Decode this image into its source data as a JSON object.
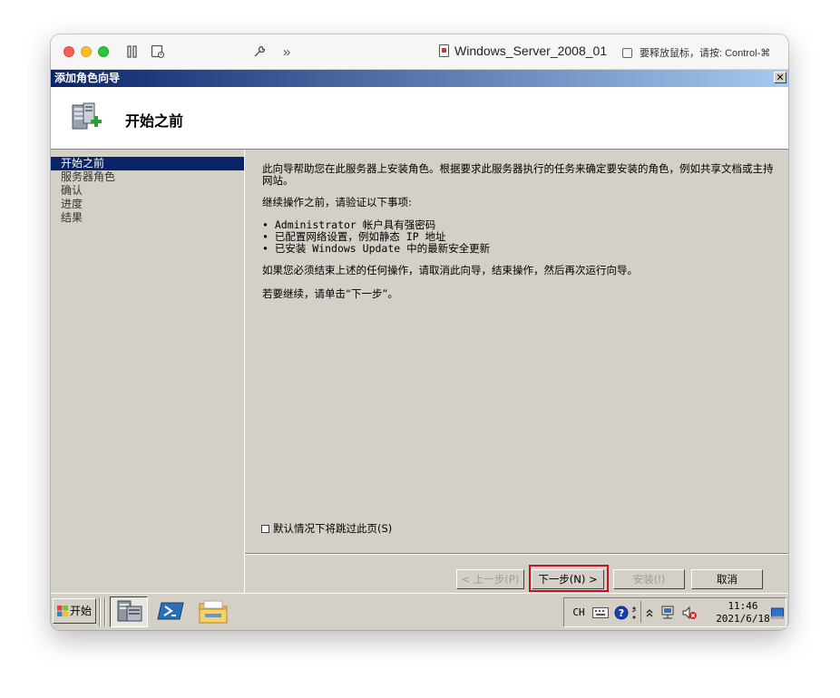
{
  "mac": {
    "vm_name": "Windows_Server_2008_01",
    "release_hint": "要释放鼠标，请按: Control-⌘"
  },
  "dialog": {
    "title": "添加角色向导",
    "close_glyph": "✕",
    "header_title": "开始之前"
  },
  "sidebar": {
    "items": [
      {
        "label": "开始之前",
        "active": true
      },
      {
        "label": "服务器角色",
        "active": false
      },
      {
        "label": "确认",
        "active": false
      },
      {
        "label": "进度",
        "active": false
      },
      {
        "label": "结果",
        "active": false
      }
    ]
  },
  "content": {
    "intro": "此向导帮助您在此服务器上安装角色。根据要求此服务器执行的任务来确定要安装的角色，例如共享文档或主持网站。",
    "verify": "继续操作之前，请验证以下事项:",
    "bullets": [
      "• Administrator 帐户具有强密码",
      "• 已配置网络设置，例如静态 IP 地址",
      "• 已安装 Windows Update 中的最新安全更新"
    ],
    "finish_note": "如果您必须结束上述的任何操作，请取消此向导，结束操作，然后再次运行向导。",
    "continue_note": "若要继续，请单击“下一步”。",
    "skip_label": "默认情况下将跳过此页(S)"
  },
  "buttons": {
    "prev": "< 上一步(P)",
    "next": "下一步(N) >",
    "install": "安装(I)",
    "cancel": "取消"
  },
  "taskbar": {
    "start_label": "开始",
    "lang": "CH",
    "time": "11:46",
    "date": "2021/6/18"
  }
}
